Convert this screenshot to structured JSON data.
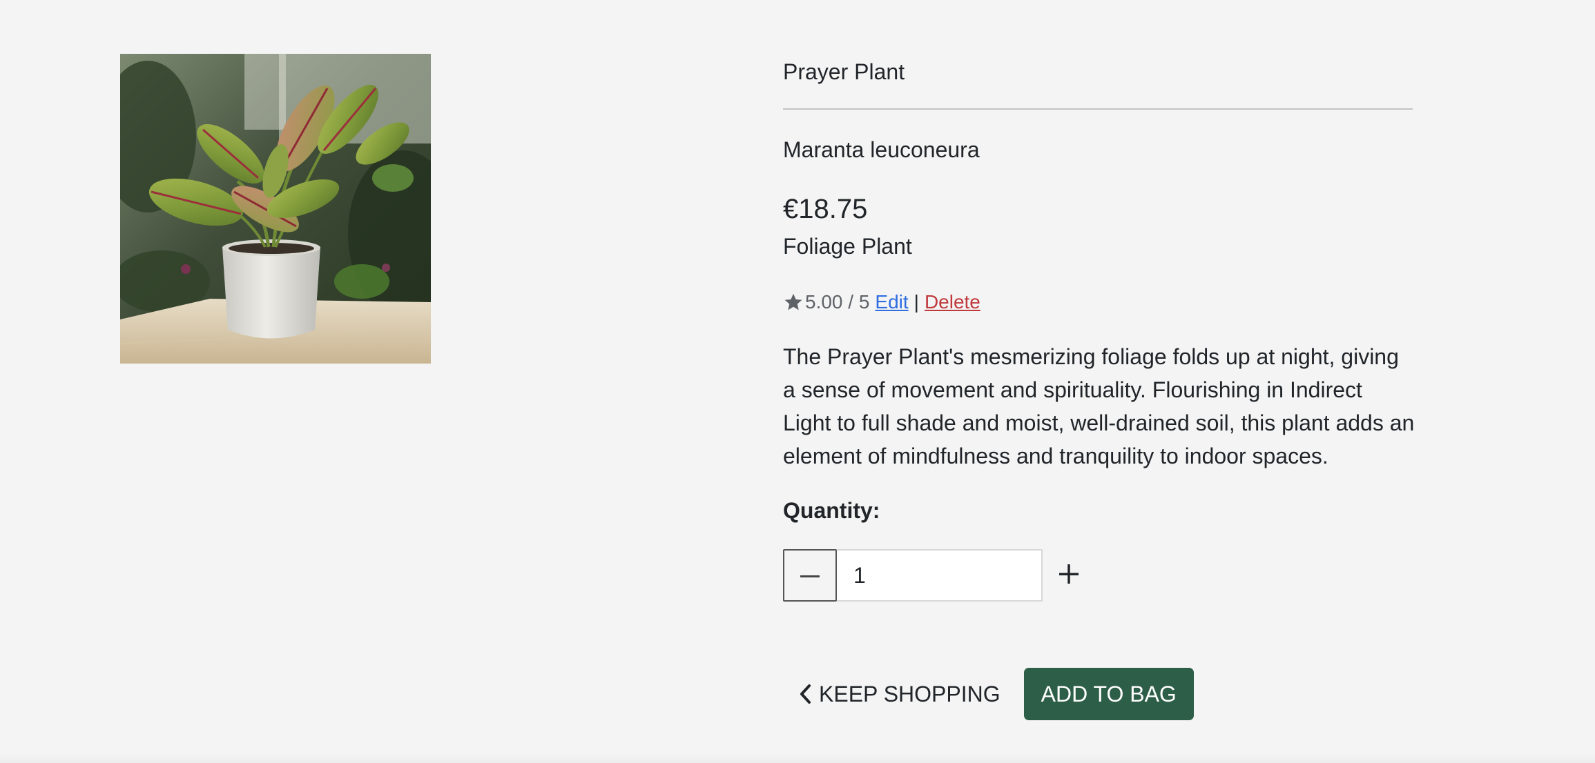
{
  "product": {
    "image_alt": "Prayer Plant",
    "name": "Prayer Plant",
    "botanical_name": "Maranta leuconeura",
    "price": "€18.75",
    "category": "Foliage Plant",
    "rating": {
      "icon": "star-icon",
      "value_text": "5.00 / 5",
      "value": 5.0,
      "max": 5
    },
    "admin_links": {
      "edit_label": "Edit",
      "separator": "|",
      "delete_label": "Delete"
    },
    "description": "The Prayer Plant's mesmerizing foliage folds up at night, giving a sense of movement and spirituality. Flourishing in Indirect Light to full shade and moist, well-drained soil, this plant adds an element of mindfulness and tranquility to indoor spaces."
  },
  "quantity": {
    "label": "Quantity:",
    "value": "1",
    "decrement_icon": "minus-icon",
    "increment_icon": "plus-icon"
  },
  "actions": {
    "keep_shopping_label": "KEEP SHOPPING",
    "keep_shopping_icon": "chevron-left-icon",
    "add_to_bag_label": "ADD TO BAG"
  },
  "colors": {
    "page_background": "#f4f4f4",
    "primary_button": "#2c5e48",
    "edit_link": "#2f6de1",
    "delete_link": "#c0393b",
    "muted_text": "#5f6368"
  }
}
